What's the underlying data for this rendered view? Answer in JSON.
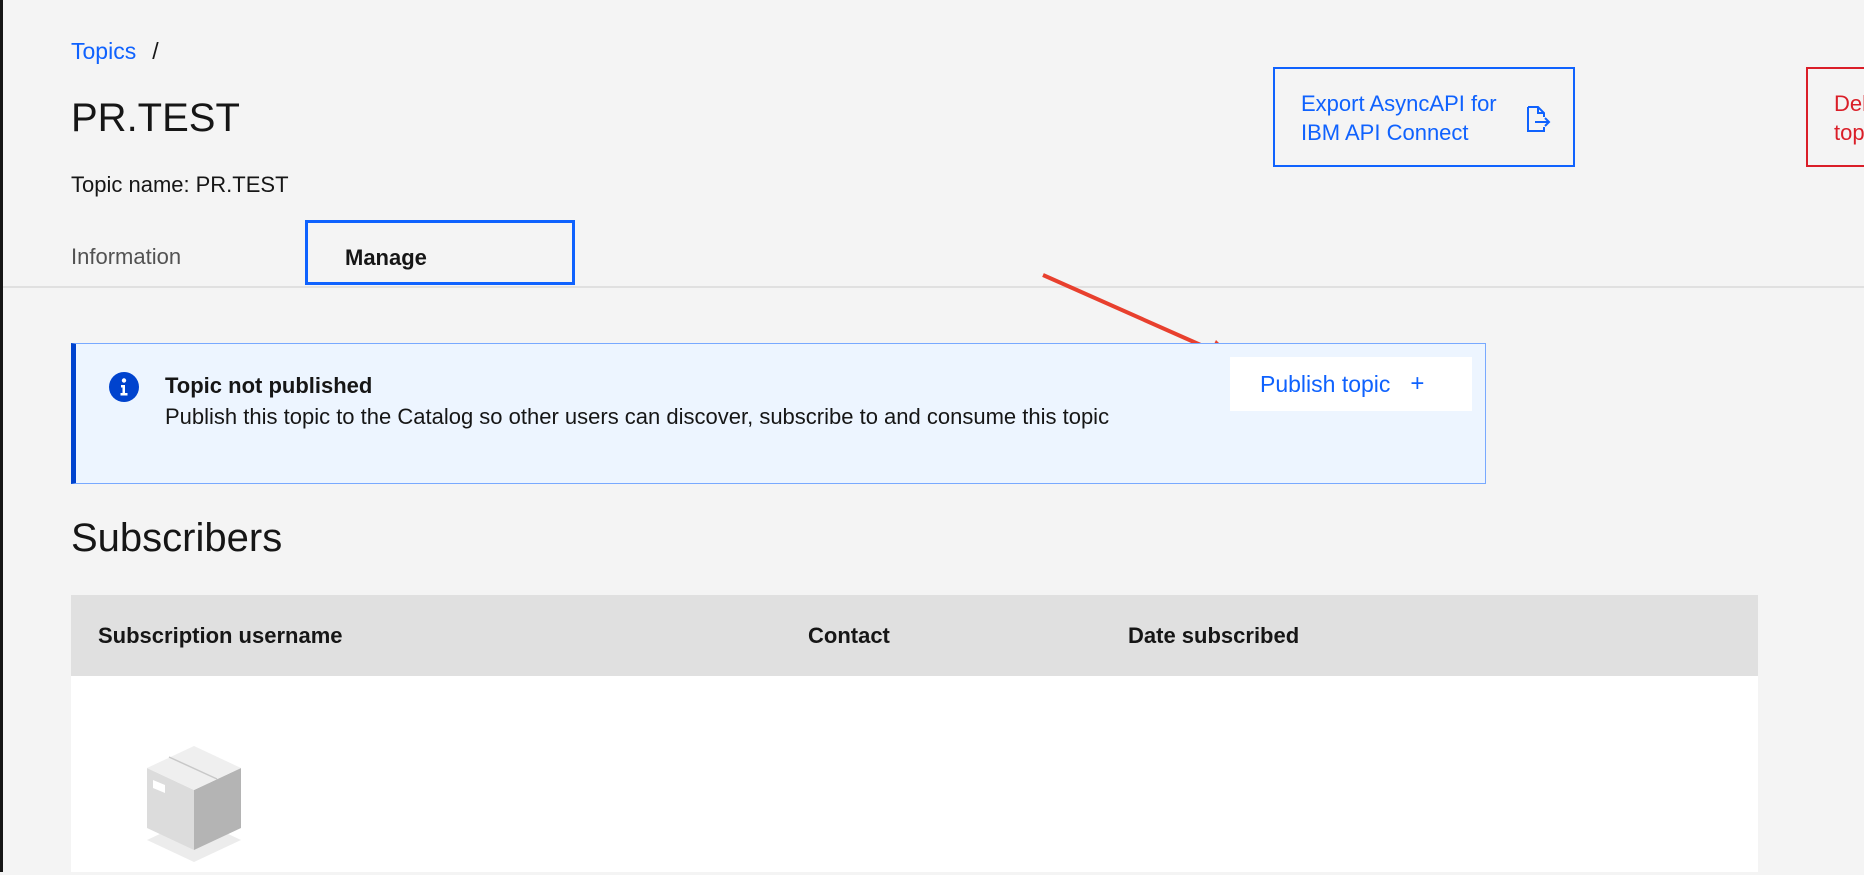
{
  "breadcrumb": {
    "link": "Topics",
    "separator": "/"
  },
  "page": {
    "title": "PR.TEST",
    "topic_name_label": "Topic name:",
    "topic_name_value": "PR.TEST"
  },
  "actions": {
    "export_label": "Export AsyncAPI for IBM API Connect",
    "delete_label": "Delete topic"
  },
  "tabs": [
    {
      "label": "Information",
      "selected": false
    },
    {
      "label": "Manage",
      "selected": true
    }
  ],
  "notification": {
    "kind": "info",
    "title": "Topic not published",
    "body": "Publish this topic to the Catalog so other users can discover, subscribe to and consume this topic",
    "action_label": "Publish topic",
    "action_icon": "plus-icon"
  },
  "subscribers": {
    "title": "Subscribers",
    "columns": [
      "Subscription username",
      "Contact",
      "Date subscribed"
    ],
    "rows": [],
    "empty_icon": "empty-box-icon"
  },
  "colors": {
    "accent": "#0f62fe",
    "danger": "#da1e28",
    "info_background": "#edf5ff",
    "annotation_arrow": "#e8402e"
  }
}
